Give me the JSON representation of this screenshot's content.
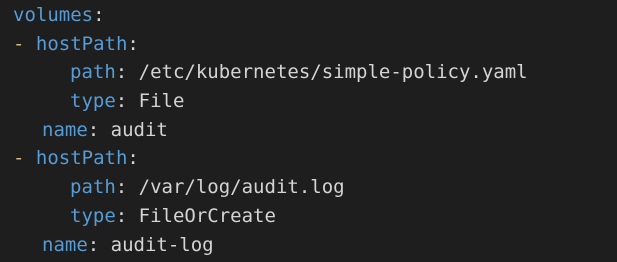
{
  "code": {
    "lines": [
      {
        "key": "volumes",
        "sep": ":"
      },
      {
        "dash": "-",
        "key": "hostPath",
        "sep": ":"
      },
      {
        "key": "path",
        "sep": ":",
        "value": "/etc/kubernetes/simple-policy.yaml"
      },
      {
        "key": "type",
        "sep": ":",
        "value": "File"
      },
      {
        "key": "name",
        "sep": ":",
        "value": "audit"
      },
      {
        "dash": "-",
        "key": "hostPath",
        "sep": ":"
      },
      {
        "key": "path",
        "sep": ":",
        "value": "/var/log/audit.log"
      },
      {
        "key": "type",
        "sep": ":",
        "value": "FileOrCreate"
      },
      {
        "key": "name",
        "sep": ":",
        "value": "audit-log"
      }
    ]
  },
  "colors": {
    "background": "#1e1e1e",
    "key": "#569cd6",
    "dash": "#d7ba7d",
    "text": "#d4d4d4"
  }
}
